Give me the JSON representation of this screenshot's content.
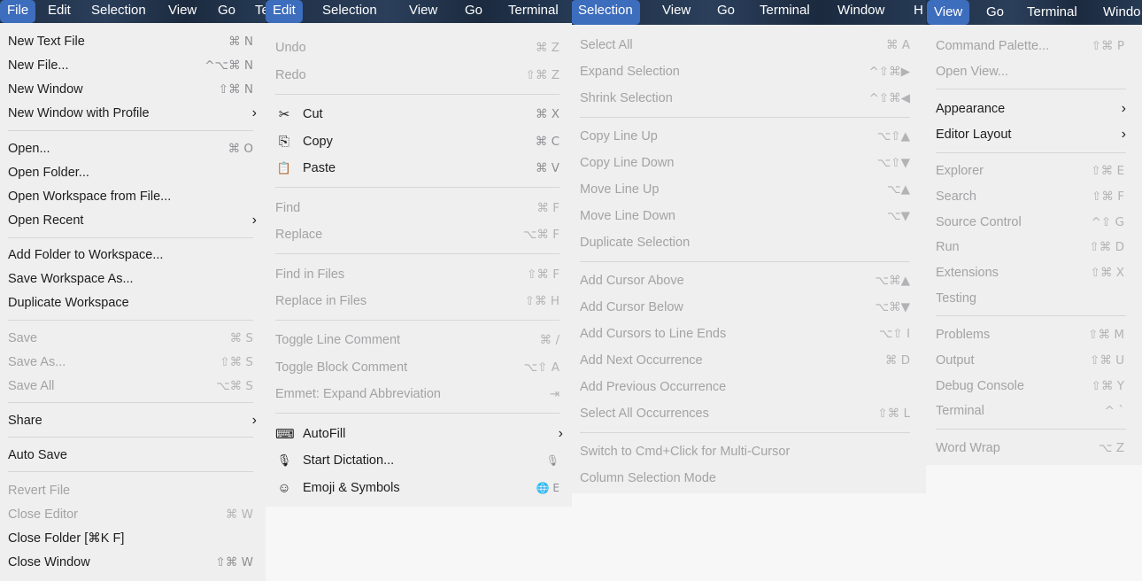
{
  "file": {
    "menubar": [
      "File",
      "Edit",
      "Selection",
      "View",
      "Go",
      "Te"
    ],
    "items": [
      {
        "label": "New Text File",
        "sc": "⌘ N"
      },
      {
        "label": "New File...",
        "sc": "^⌥⌘ N"
      },
      {
        "label": "New Window",
        "sc": "⇧⌘ N"
      },
      {
        "label": "New Window with Profile",
        "chev": "›"
      },
      {
        "label": "Open...",
        "sc": "⌘ O"
      },
      {
        "label": "Open Folder..."
      },
      {
        "label": "Open Workspace from File..."
      },
      {
        "label": "Open Recent",
        "chev": "›"
      },
      {
        "label": "Add Folder to Workspace..."
      },
      {
        "label": "Save Workspace As..."
      },
      {
        "label": "Duplicate Workspace"
      },
      {
        "label": "Save",
        "sc": "⌘ S"
      },
      {
        "label": "Save As...",
        "sc": "⇧⌘ S"
      },
      {
        "label": "Save All",
        "sc": "⌥⌘ S"
      },
      {
        "label": "Share",
        "chev": "›"
      },
      {
        "label": "Auto Save"
      },
      {
        "label": "Revert File"
      },
      {
        "label": "Close Editor",
        "sc": "⌘ W"
      },
      {
        "label": "Close Folder [⌘K F]"
      },
      {
        "label": "Close Window",
        "sc": "⇧⌘ W"
      }
    ]
  },
  "edit": {
    "menubar": [
      "Edit",
      "Selection",
      "View",
      "Go",
      "Terminal"
    ],
    "items": [
      {
        "label": "Undo",
        "sc": "⌘ Z"
      },
      {
        "label": "Redo",
        "sc": "⇧⌘ Z"
      },
      {
        "label": "Cut",
        "sc": "⌘ X",
        "icon": "✂"
      },
      {
        "label": "Copy",
        "sc": "⌘ C",
        "icon": "⎘"
      },
      {
        "label": "Paste",
        "sc": "⌘ V",
        "icon": "📋"
      },
      {
        "label": "Find",
        "sc": "⌘ F"
      },
      {
        "label": "Replace",
        "sc": "⌥⌘ F"
      },
      {
        "label": "Find in Files",
        "sc": "⇧⌘ F"
      },
      {
        "label": "Replace in Files",
        "sc": "⇧⌘ H"
      },
      {
        "label": "Toggle Line Comment",
        "sc": "⌘ /"
      },
      {
        "label": "Toggle Block Comment",
        "sc": "⌥⇧ A"
      },
      {
        "label": "Emmet: Expand Abbreviation",
        "sc": "⇥"
      },
      {
        "label": "AutoFill",
        "chev": "›",
        "icon": "⌨"
      },
      {
        "label": "Start Dictation...",
        "sc": "🎙",
        "icon": "🎙"
      },
      {
        "label": "Emoji & Symbols",
        "sc": "🌐 E",
        "icon": "☺"
      }
    ]
  },
  "selection": {
    "menubar": [
      "Selection",
      "View",
      "Go",
      "Terminal",
      "Window",
      "H"
    ],
    "items": [
      {
        "label": "Select All",
        "sc": "⌘ A"
      },
      {
        "label": "Expand Selection",
        "sc": "^⇧⌘▶"
      },
      {
        "label": "Shrink Selection",
        "sc": "^⇧⌘◀"
      },
      {
        "label": "Copy Line Up",
        "sc": "⌥⇧▲"
      },
      {
        "label": "Copy Line Down",
        "sc": "⌥⇧▼"
      },
      {
        "label": "Move Line Up",
        "sc": "⌥▲"
      },
      {
        "label": "Move Line Down",
        "sc": "⌥▼"
      },
      {
        "label": "Duplicate Selection"
      },
      {
        "label": "Add Cursor Above",
        "sc": "⌥⌘▲"
      },
      {
        "label": "Add Cursor Below",
        "sc": "⌥⌘▼"
      },
      {
        "label": "Add Cursors to Line Ends",
        "sc": "⌥⇧ I"
      },
      {
        "label": "Add Next Occurrence",
        "sc": "⌘ D"
      },
      {
        "label": "Add Previous Occurrence"
      },
      {
        "label": "Select All Occurrences",
        "sc": "⇧⌘ L"
      },
      {
        "label": "Switch to Cmd+Click for Multi-Cursor"
      },
      {
        "label": "Column Selection Mode"
      }
    ]
  },
  "view": {
    "menubar": [
      "View",
      "Go",
      "Terminal",
      "Windo"
    ],
    "items": [
      {
        "label": "Command Palette...",
        "sc": "⇧⌘ P"
      },
      {
        "label": "Open View..."
      },
      {
        "label": "Appearance",
        "chev": "›"
      },
      {
        "label": "Editor Layout",
        "chev": "›"
      },
      {
        "label": "Explorer",
        "sc": "⇧⌘ E"
      },
      {
        "label": "Search",
        "sc": "⇧⌘ F"
      },
      {
        "label": "Source Control",
        "sc": "^⇧ G"
      },
      {
        "label": "Run",
        "sc": "⇧⌘ D"
      },
      {
        "label": "Extensions",
        "sc": "⇧⌘ X"
      },
      {
        "label": "Testing"
      },
      {
        "label": "Problems",
        "sc": "⇧⌘ M"
      },
      {
        "label": "Output",
        "sc": "⇧⌘ U"
      },
      {
        "label": "Debug Console",
        "sc": "⇧⌘ Y"
      },
      {
        "label": "Terminal",
        "sc": "^ `"
      },
      {
        "label": "Word Wrap",
        "sc": "⌥ Z"
      }
    ]
  }
}
